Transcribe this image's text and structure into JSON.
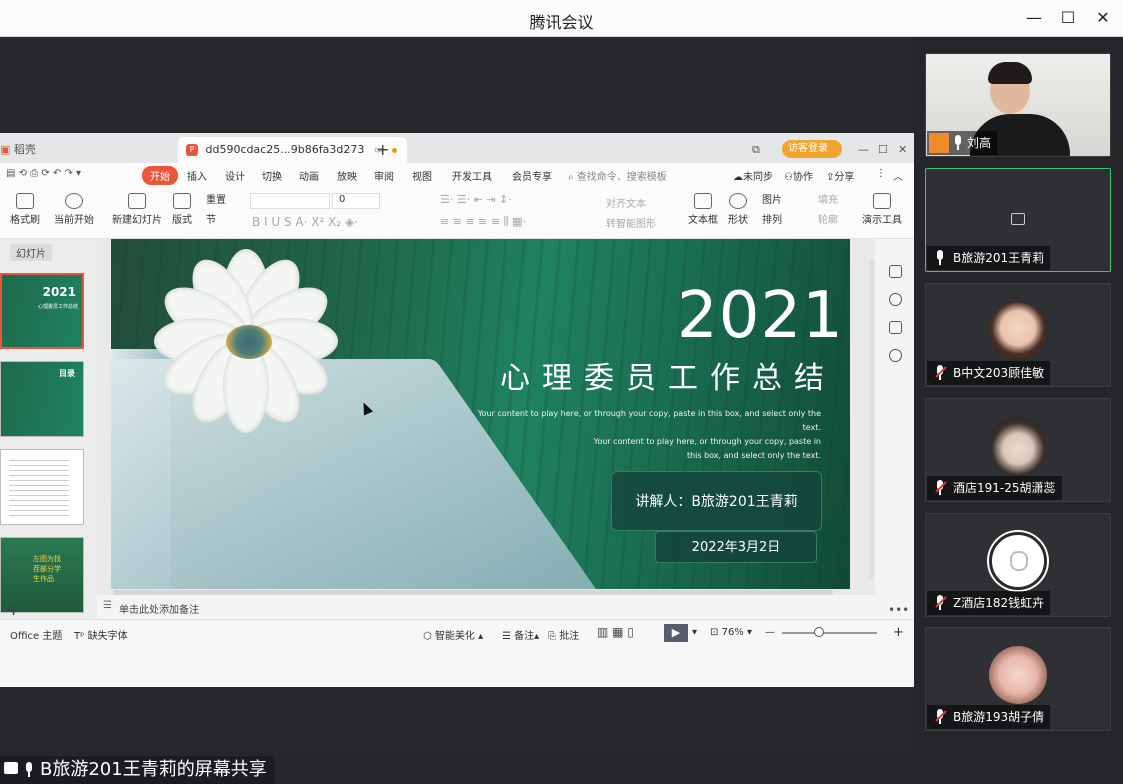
{
  "app": {
    "title": "腾讯会议"
  },
  "window_controls": {
    "minimize": "—",
    "maximize": "☐",
    "close": "✕"
  },
  "wps": {
    "tabs": {
      "home": "稻壳",
      "doc": "dd590cdac25...9b86fa3d273"
    },
    "login": "访客登录",
    "menu": [
      "开始",
      "插入",
      "设计",
      "切换",
      "动画",
      "放映",
      "审阅",
      "视图",
      "开发工具",
      "会员专享"
    ],
    "search": "查找命令、搜索模板",
    "menu_right": [
      "未同步",
      "协作",
      "分享"
    ],
    "ribbon": {
      "format_painter": "格式刷",
      "start_from_current": "当前开始",
      "new_slide": "新建幻灯片",
      "layout": "版式",
      "reset": "重置",
      "section": "节",
      "font_size": "0",
      "align_text": "对齐文本",
      "convert_smartart": "转智能图形",
      "textbox": "文本框",
      "shape": "形状",
      "picture": "图片",
      "fill": "填充",
      "arrange": "排列",
      "outline": "轮廓",
      "presentation_tools": "演示工具"
    },
    "panel": {
      "label": "幻灯片",
      "thumb1_year": "2021",
      "thumb1_title": "心理委员工作总结",
      "thumb2_title": "目录",
      "thumb4_text": "左图为找茬部分学生作品"
    },
    "notes": "单击此处添加备注",
    "status": {
      "theme": "Office 主题",
      "missing_font": "缺失字体",
      "smart_beautify": "智能美化",
      "notes_btn": "备注",
      "comments_btn": "批注",
      "zoom": "76%"
    }
  },
  "slide": {
    "year": "2021",
    "title": "心理委员工作总结",
    "body": [
      "Your content to play here, or through your copy, paste in this box, and select only the text.",
      "Your content to play here, or through your copy, paste in",
      "this box, and select only the text."
    ],
    "speaker": "讲解人：B旅游201王青莉",
    "date": "2022年3月2日"
  },
  "participants": [
    {
      "name": "刘高",
      "muted": false,
      "host": true
    },
    {
      "name": "B旅游201王青莉",
      "muted": false,
      "speaking": true,
      "video_off": true
    },
    {
      "name": "B中文203顾佳敏",
      "muted": true
    },
    {
      "name": "酒店191-25胡潇蕊",
      "muted": true
    },
    {
      "name": "Z酒店182钱虹卉",
      "muted": true
    },
    {
      "name": "B旅游193胡子倩",
      "muted": true
    }
  ],
  "share_label": "B旅游201王青莉的屏幕共享",
  "colors": {
    "wps_accent": "#e8573b",
    "slide_green": "#1f7a57",
    "active_border": "#3ac46c"
  }
}
